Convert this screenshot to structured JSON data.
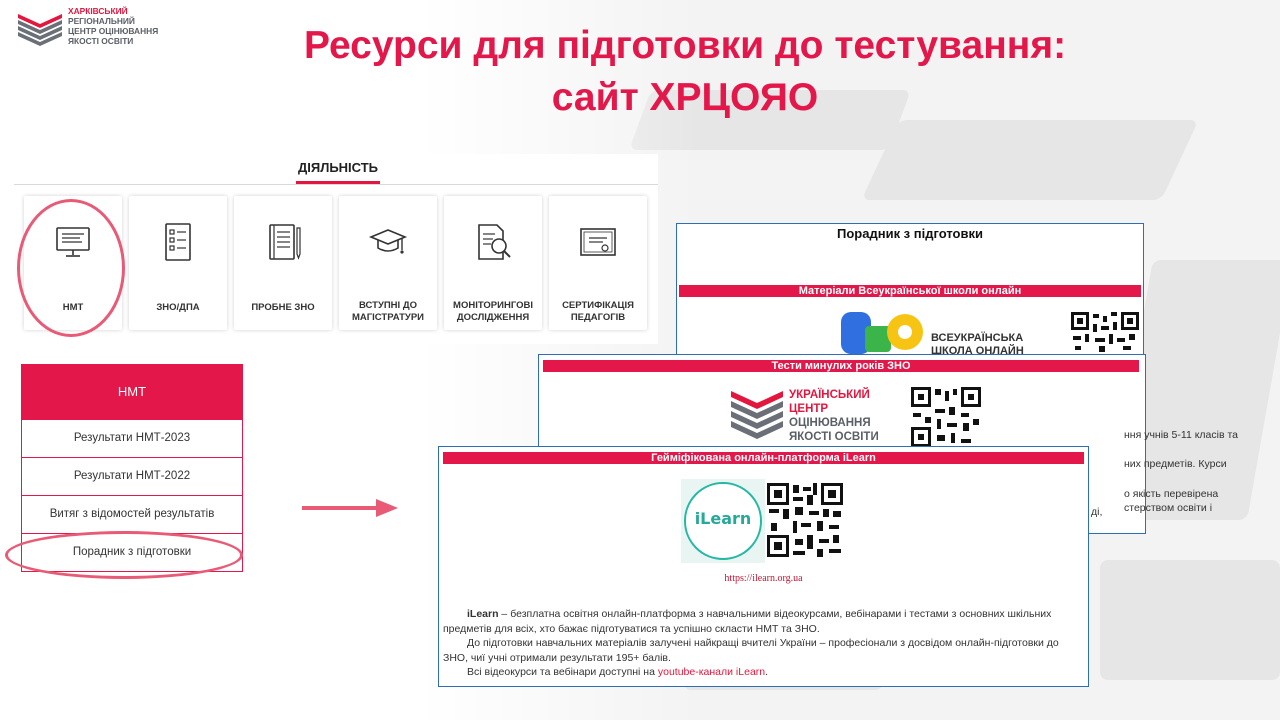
{
  "logo": {
    "lines": [
      "ХАРКІВСЬКИЙ",
      "РЕГІОНАЛЬНИЙ",
      "ЦЕНТР ОЦІНЮВАННЯ",
      "ЯКОСТІ ОСВІТИ"
    ]
  },
  "title": {
    "line1": "Ресурси для підготовки до тестування:",
    "line2": "сайт ХРЦОЯО"
  },
  "activities": {
    "heading": "ДІЯЛЬНІСТЬ",
    "cards": [
      {
        "label": "НМТ",
        "icon": "monitor-icon"
      },
      {
        "label": "ЗНО/ДПА",
        "icon": "checklist-icon"
      },
      {
        "label": "ПРОБНЕ ЗНО",
        "icon": "notebook-icon"
      },
      {
        "label": "ВСТУПНІ ДО МАГІСТРАТУРИ",
        "icon": "graduation-cap-icon"
      },
      {
        "label": "МОНІТОРИНГОВІ ДОСЛІДЖЕННЯ",
        "icon": "document-search-icon"
      },
      {
        "label": "СЕРТИФІКАЦІЯ ПЕДАГОГІВ",
        "icon": "certificate-icon"
      }
    ]
  },
  "nmt_menu": {
    "heading": "НМТ",
    "items": [
      "Результати НМТ-2023",
      "Результати НМТ-2022",
      "Витяг з відомостей результатів",
      "Порадник з підготовки"
    ]
  },
  "card_guide": {
    "heading": "Порадник з підготовки",
    "band": "Матеріали Всеукраїнської школи онлайн",
    "vso_text": [
      "ВСЕУКРАЇНСЬКА",
      "ШКОЛА ОНЛАЙН"
    ],
    "peek_lines": [
      "ння учнів 5-11 класів та",
      "них предметів. Курси",
      "о якість перевірена",
      "стерством освіти і",
      "ді,"
    ]
  },
  "card_tests": {
    "band": "Тести минулих років ЗНО",
    "logo_lines": [
      "УКРАЇНСЬКИЙ",
      "ЦЕНТР",
      "ОЦІНЮВАННЯ",
      "ЯКОСТІ ОСВІТИ"
    ]
  },
  "card_ilearn": {
    "band": "Гейміфікована онлайн-платформа iLearn",
    "logo_text": "iLearn",
    "url": "https://ilearn.org.ua",
    "p1_bold": "iLearn",
    "p1": " – безплатна освітня онлайн-платформа з навчальними відеокурсами, вебінарами і тестами з основних шкільних предметів для всіх, хто бажає підготуватися та успішно скласти НМТ та ЗНО.",
    "p2": "До підготовки навчальних матеріалів залучені найкращі вчителі України – професіонали з досвідом онлайн-підготовки до ЗНО, чиї учні отримали результати 195+ балів.",
    "p3_prefix": "Всі відеокурси та вебінари доступні на ",
    "p3_link": "youtube-канали iLearn",
    "p3_suffix": "."
  },
  "colors": {
    "accent": "#e3174a",
    "annotation": "#e85a76",
    "card_border": "#2f6db5",
    "ilearn": "#26b7a5"
  }
}
